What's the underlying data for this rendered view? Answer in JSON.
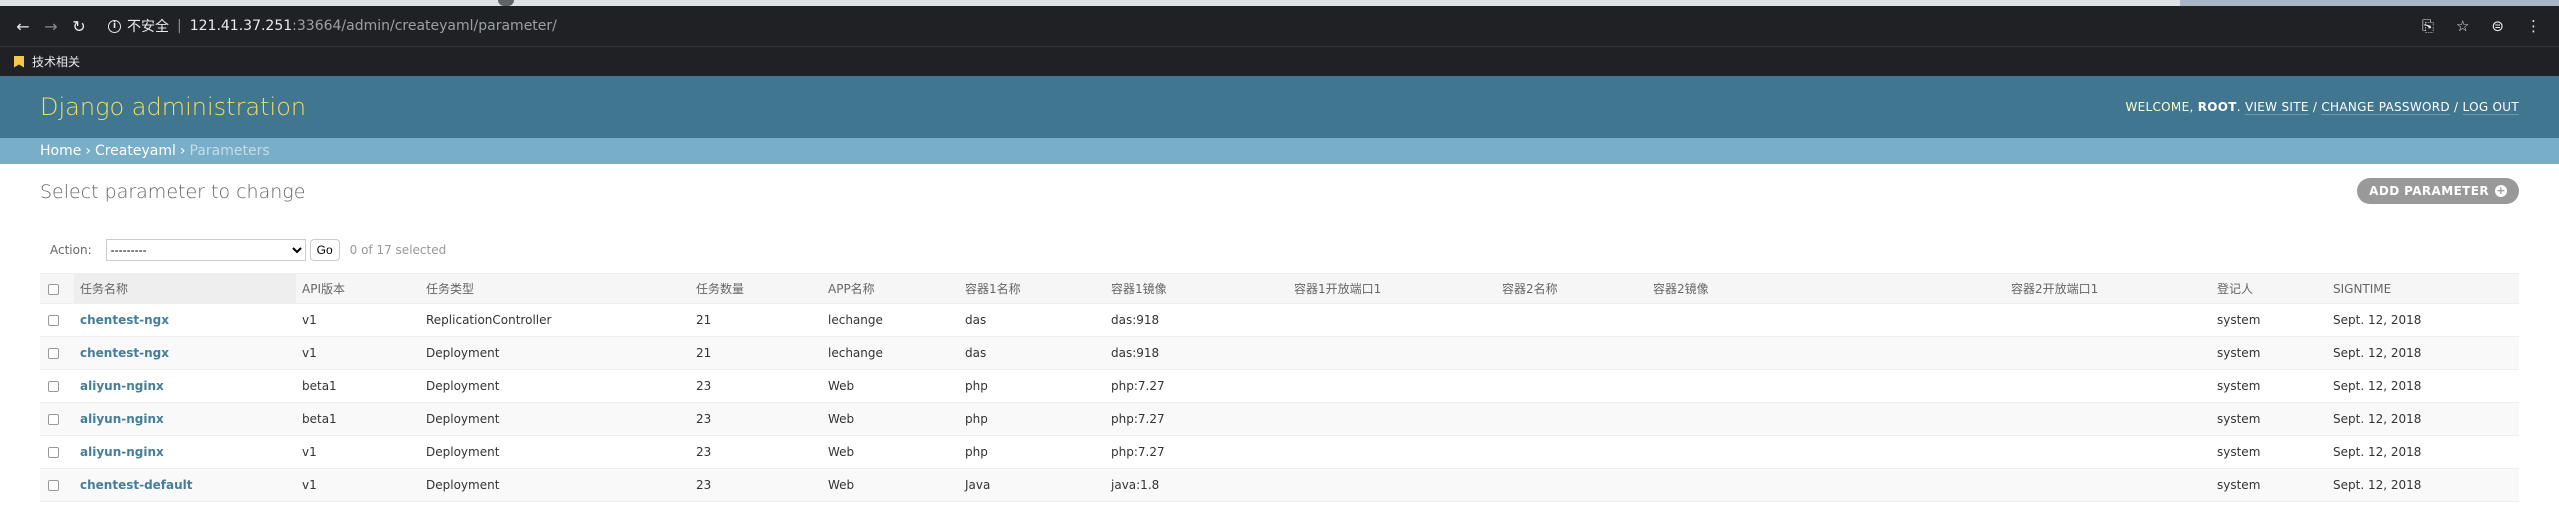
{
  "browser": {
    "insecure_label": "不安全",
    "url_host": "121.41.37.251",
    "url_rest": ":33664/admin/createyaml/parameter/",
    "bookmark_label": "技术相关"
  },
  "header": {
    "branding": "Django administration",
    "welcome": "WELCOME,",
    "user": "ROOT",
    "view_site": "VIEW SITE",
    "change_password": "CHANGE PASSWORD",
    "log_out": "LOG OUT",
    "sep": "/"
  },
  "breadcrumbs": {
    "home": "Home",
    "app": "Createyaml",
    "current": "Parameters",
    "sep": "›"
  },
  "content": {
    "title": "Select parameter to change",
    "add_button": "ADD PARAMETER",
    "action_label": "Action:",
    "action_selected": "---------",
    "go_label": "Go",
    "counter": "0 of 17 selected"
  },
  "table": {
    "headers": [
      "任务名称",
      "API版本",
      "任务类型",
      "任务数量",
      "APP名称",
      "容器1名称",
      "容器1镜像",
      "容器1开放端口1",
      "容器2名称",
      "容器2镜像",
      "容器2开放端口1",
      "登记人",
      "SIGNTIME"
    ],
    "rows": [
      [
        "chentest-ngx",
        "v1",
        "ReplicationController",
        "21",
        "lechange",
        "das",
        "das:918",
        "",
        "",
        "",
        "",
        "system",
        "Sept. 12, 2018"
      ],
      [
        "chentest-ngx",
        "v1",
        "Deployment",
        "21",
        "lechange",
        "das",
        "das:918",
        "",
        "",
        "",
        "",
        "system",
        "Sept. 12, 2018"
      ],
      [
        "aliyun-nginx",
        "beta1",
        "Deployment",
        "23",
        "Web",
        "php",
        "php:7.27",
        "",
        "",
        "",
        "",
        "system",
        "Sept. 12, 2018"
      ],
      [
        "aliyun-nginx",
        "beta1",
        "Deployment",
        "23",
        "Web",
        "php",
        "php:7.27",
        "",
        "",
        "",
        "",
        "system",
        "Sept. 12, 2018"
      ],
      [
        "aliyun-nginx",
        "v1",
        "Deployment",
        "23",
        "Web",
        "php",
        "php:7.27",
        "",
        "",
        "",
        "",
        "system",
        "Sept. 12, 2018"
      ],
      [
        "chentest-default",
        "v1",
        "Deployment",
        "23",
        "Web",
        "Java",
        "java:1.8",
        "",
        "",
        "",
        "",
        "system",
        "Sept. 12, 2018"
      ]
    ]
  }
}
